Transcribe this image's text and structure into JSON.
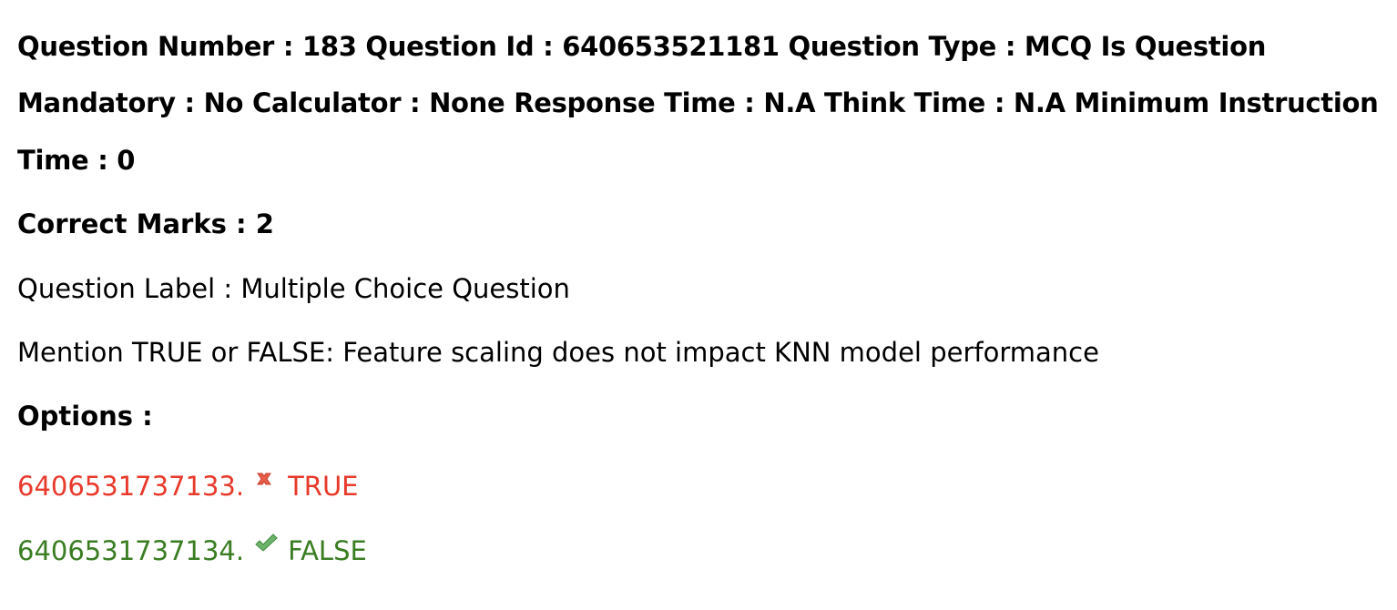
{
  "header": {
    "line1": "Question Number : 183 Question Id : 640653521181 Question Type : MCQ Is Question",
    "line2": "Mandatory : No Calculator : None Response Time : N.A Think Time : N.A Minimum Instruction",
    "line3": "Time : 0"
  },
  "marks": {
    "correct": "Correct Marks : 2"
  },
  "question": {
    "label": "Question Label : Multiple Choice Question",
    "text": "Mention TRUE or FALSE: Feature scaling does not impact KNN model performance"
  },
  "options": {
    "heading": "Options :",
    "items": [
      {
        "id": "6406531737133.",
        "label": "TRUE",
        "status": "incorrect",
        "icon": "cross-icon",
        "color": "#e8392b"
      },
      {
        "id": "6406531737134.",
        "label": "FALSE",
        "status": "correct",
        "icon": "check-icon",
        "color": "#3a7d22"
      }
    ]
  }
}
